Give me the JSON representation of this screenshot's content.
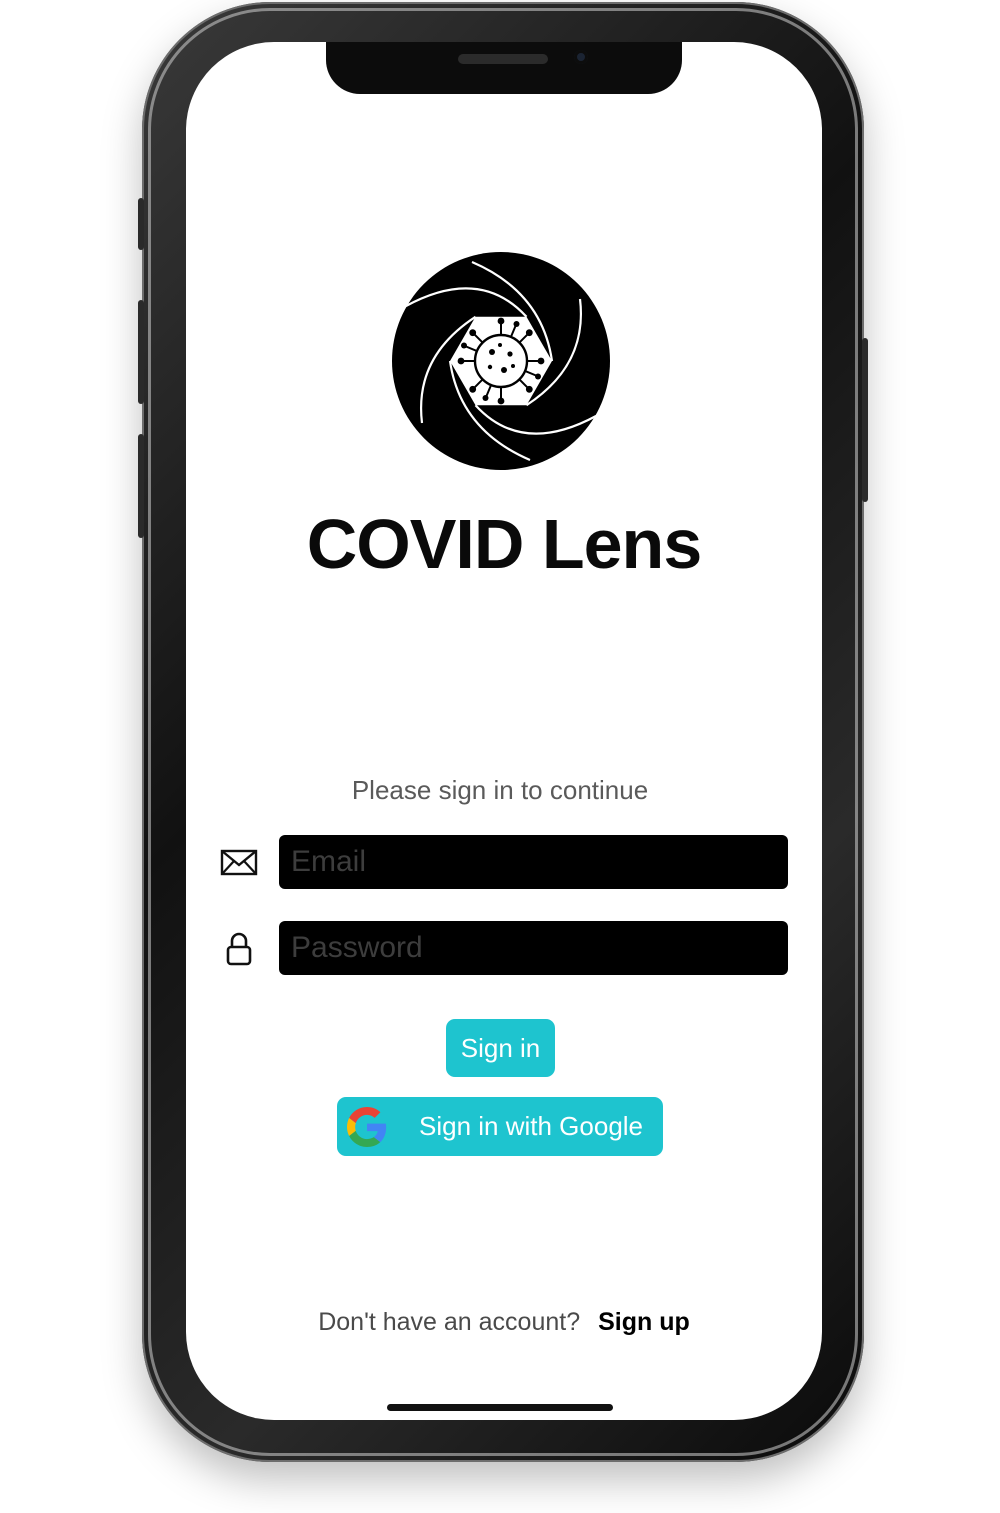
{
  "app": {
    "title": "COVID Lens"
  },
  "login": {
    "prompt": "Please sign in to continue",
    "email_placeholder": "Email",
    "email_value": "",
    "password_placeholder": "Password",
    "password_value": "",
    "sign_in_label": "Sign in",
    "google_label": "Sign in with Google"
  },
  "footer": {
    "question": "Don't have an account?",
    "signup_label": "Sign up"
  },
  "icons": {
    "logo": "covid-lens-logo-icon",
    "email": "envelope-icon",
    "password": "lock-icon",
    "google": "google-g-icon"
  },
  "colors": {
    "accent": "#1ec4cf",
    "field_bg": "#000000",
    "title": "#0a0a0a"
  }
}
